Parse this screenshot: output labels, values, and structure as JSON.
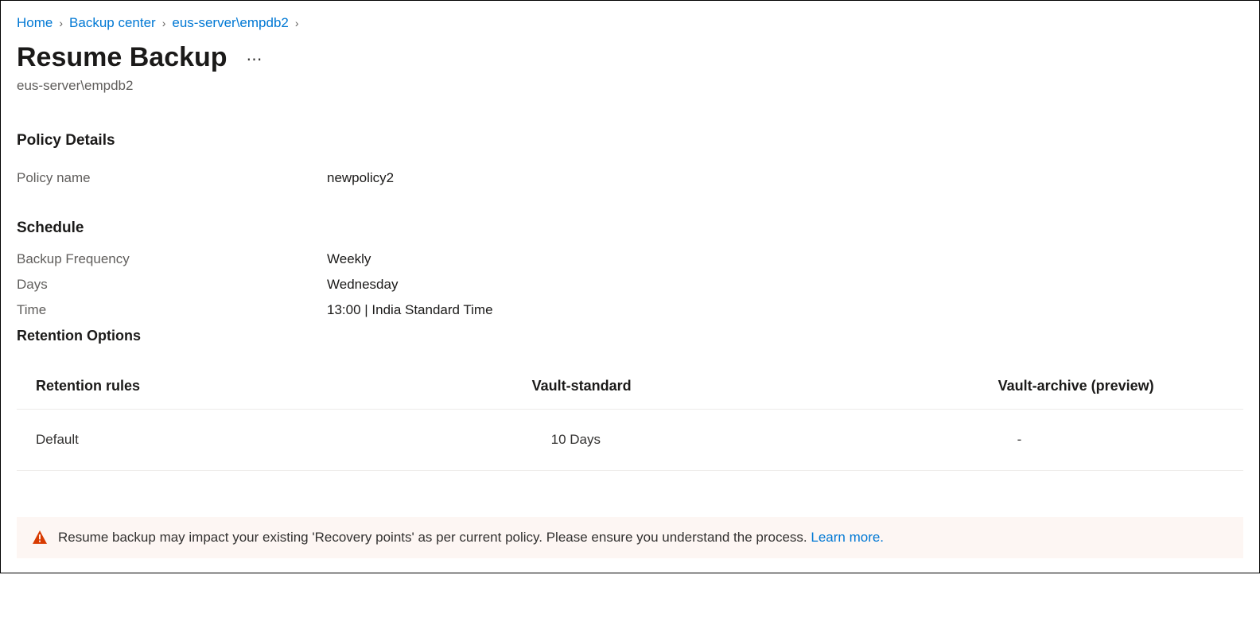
{
  "breadcrumb": {
    "items": [
      "Home",
      "Backup center",
      "eus-server\\empdb2"
    ]
  },
  "header": {
    "title": "Resume Backup",
    "subtitle": "eus-server\\empdb2"
  },
  "policy_details": {
    "heading": "Policy Details",
    "name_label": "Policy name",
    "name_value": "newpolicy2"
  },
  "schedule": {
    "heading": "Schedule",
    "frequency_label": "Backup Frequency",
    "frequency_value": "Weekly",
    "days_label": "Days",
    "days_value": "Wednesday",
    "time_label": "Time",
    "time_value": "13:00 | India Standard Time"
  },
  "retention": {
    "heading": "Retention Options",
    "columns": {
      "rules": "Retention rules",
      "standard": "Vault-standard",
      "archive": "Vault-archive (preview)"
    },
    "rows": [
      {
        "rule": "Default",
        "standard": "10 Days",
        "archive": "-"
      }
    ]
  },
  "banner": {
    "text": "Resume backup may impact your existing 'Recovery points' as per current policy. Please ensure you understand the process. ",
    "learn_more": "Learn more."
  }
}
